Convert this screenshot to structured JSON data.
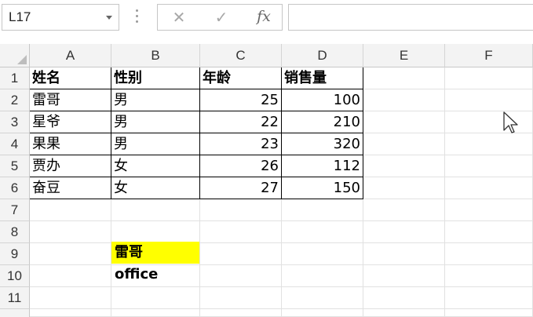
{
  "name_box": {
    "value": "L17"
  },
  "formula_bar": {
    "cancel_icon": "✕",
    "enter_icon": "✓",
    "function_icon": "fx",
    "value": ""
  },
  "columns": [
    "A",
    "B",
    "C",
    "D",
    "E",
    "F"
  ],
  "rows": [
    "1",
    "2",
    "3",
    "4",
    "5",
    "6",
    "7",
    "8",
    "9",
    "10",
    "11"
  ],
  "table": {
    "headers": [
      "姓名",
      "性别",
      "年龄",
      "销售量"
    ],
    "records": [
      [
        "雷哥",
        "男",
        "25",
        "100"
      ],
      [
        "星爷",
        "男",
        "22",
        "210"
      ],
      [
        "果果",
        "男",
        "23",
        "320"
      ],
      [
        "贾办",
        "女",
        "26",
        "112"
      ],
      [
        "奋豆",
        "女",
        "27",
        "150"
      ]
    ]
  },
  "highlight_cell": {
    "ref": "B9",
    "value": "雷哥office",
    "fill": "#ffff00"
  }
}
